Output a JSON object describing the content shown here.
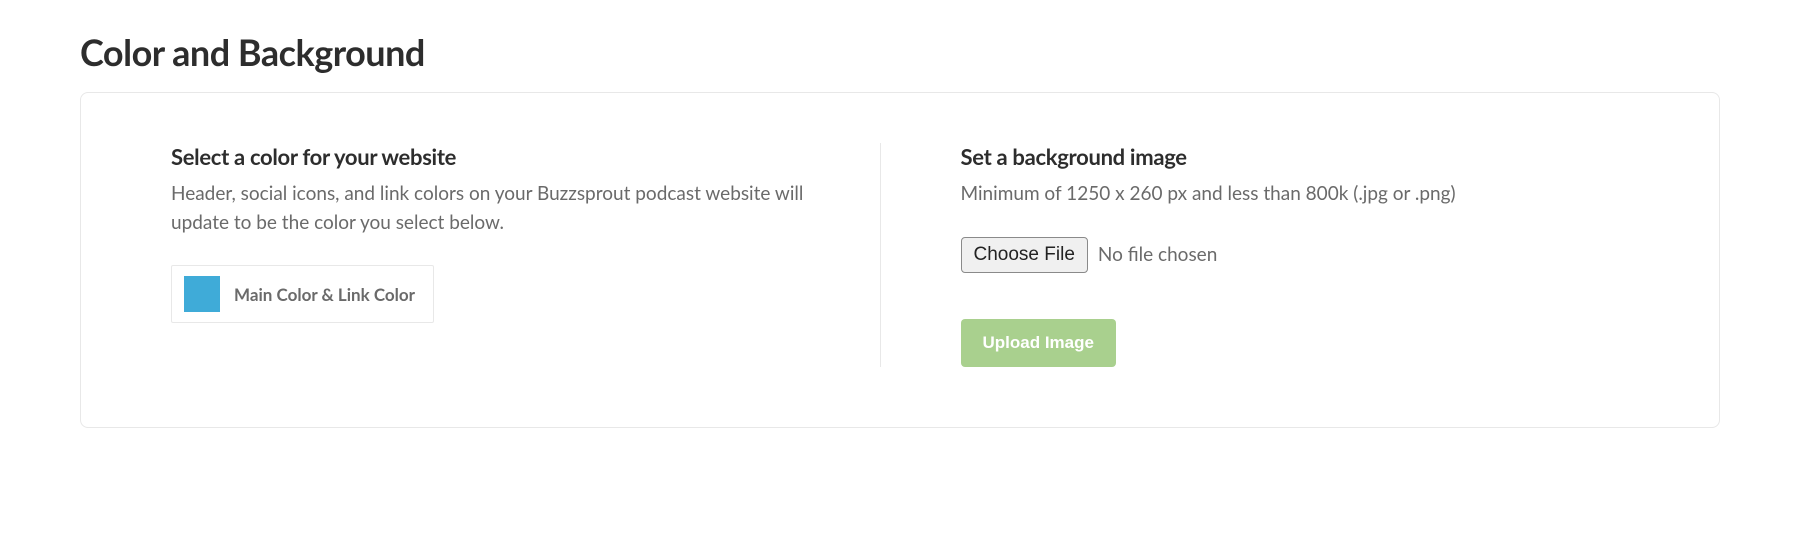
{
  "page_title": "Color and Background",
  "color_section": {
    "heading": "Select a color for your website",
    "description": "Header, social icons, and link colors on your Buzzsprout podcast website will update to be the color you select below.",
    "swatch_color": "#3fabd8",
    "picker_label": "Main Color & Link Color"
  },
  "background_section": {
    "heading": "Set a background image",
    "description": "Minimum of 1250 x 260 px and less than 800k (.jpg or .png)",
    "choose_file_label": "Choose File",
    "file_status": "No file chosen",
    "upload_button_label": "Upload Image"
  }
}
